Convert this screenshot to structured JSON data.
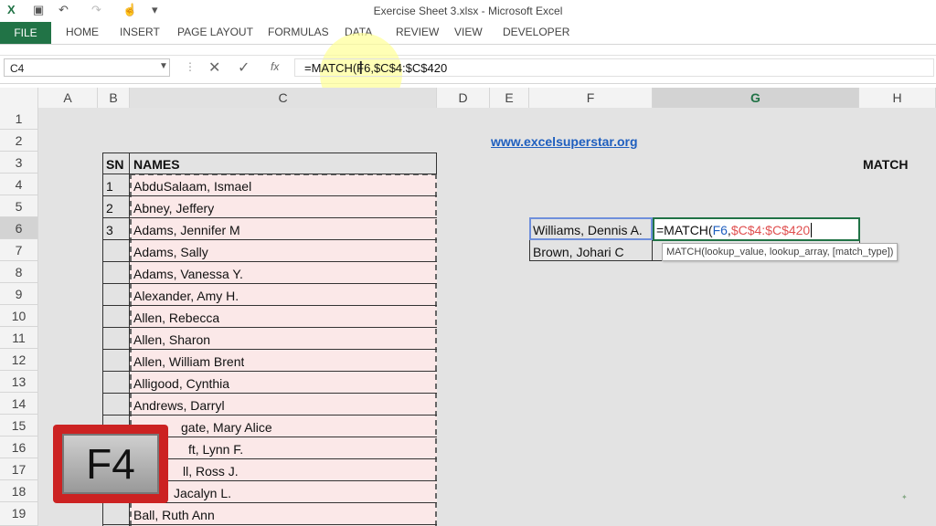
{
  "window": {
    "title": "Exercise Sheet 3.xlsx - Microsoft Excel"
  },
  "ribbon": {
    "tabs": [
      "FILE",
      "HOME",
      "INSERT",
      "PAGE LAYOUT",
      "FORMULAS",
      "DATA",
      "REVIEW",
      "VIEW",
      "DEVELOPER"
    ]
  },
  "formula_bar": {
    "name_box": "C4",
    "formula": "=MATCH(F6,$C$4:$C$420",
    "fx": "fx"
  },
  "columns": [
    "A",
    "B",
    "C",
    "D",
    "E",
    "F",
    "G",
    "H"
  ],
  "rows": [
    "1",
    "2",
    "3",
    "4",
    "5",
    "6",
    "7",
    "8",
    "9",
    "10",
    "11",
    "12",
    "13",
    "14",
    "15",
    "16",
    "17",
    "18",
    "19"
  ],
  "sheet": {
    "website": "www.excelsuperstar.org",
    "header_sn": "SN",
    "header_names": "NAMES",
    "match_label": "MATCH",
    "sn": [
      "1",
      "2",
      "3"
    ],
    "names": [
      "AbduSalaam, Ismael",
      "Abney, Jeffery",
      "Adams, Jennifer M",
      "Adams, Sally",
      "Adams, Vanessa Y.",
      "Alexander, Amy H.",
      "Allen, Rebecca",
      "Allen, Sharon",
      "Allen, William Brent",
      "Alligood, Cynthia",
      "Andrews, Darryl",
      "gate, Mary Alice",
      "ft, Lynn F.",
      "ll, Ross J.",
      "Jacalyn L.",
      "Ball, Ruth Ann"
    ],
    "f6": "Williams, Dennis A.",
    "f7": "Brown, Johari C",
    "g6_prefix": "=MATCH(",
    "g6_arg1": "F6",
    "g6_sep": ",",
    "g6_arg2": "$C$4:$C$420",
    "tooltip": "MATCH(lookup_value, lookup_array, [match_type])"
  },
  "overlay_key": "F4",
  "colors": {
    "excel_green": "#217346",
    "link_blue": "#1f5fbf",
    "range_red": "#e05050",
    "key_red": "#cc2222"
  }
}
